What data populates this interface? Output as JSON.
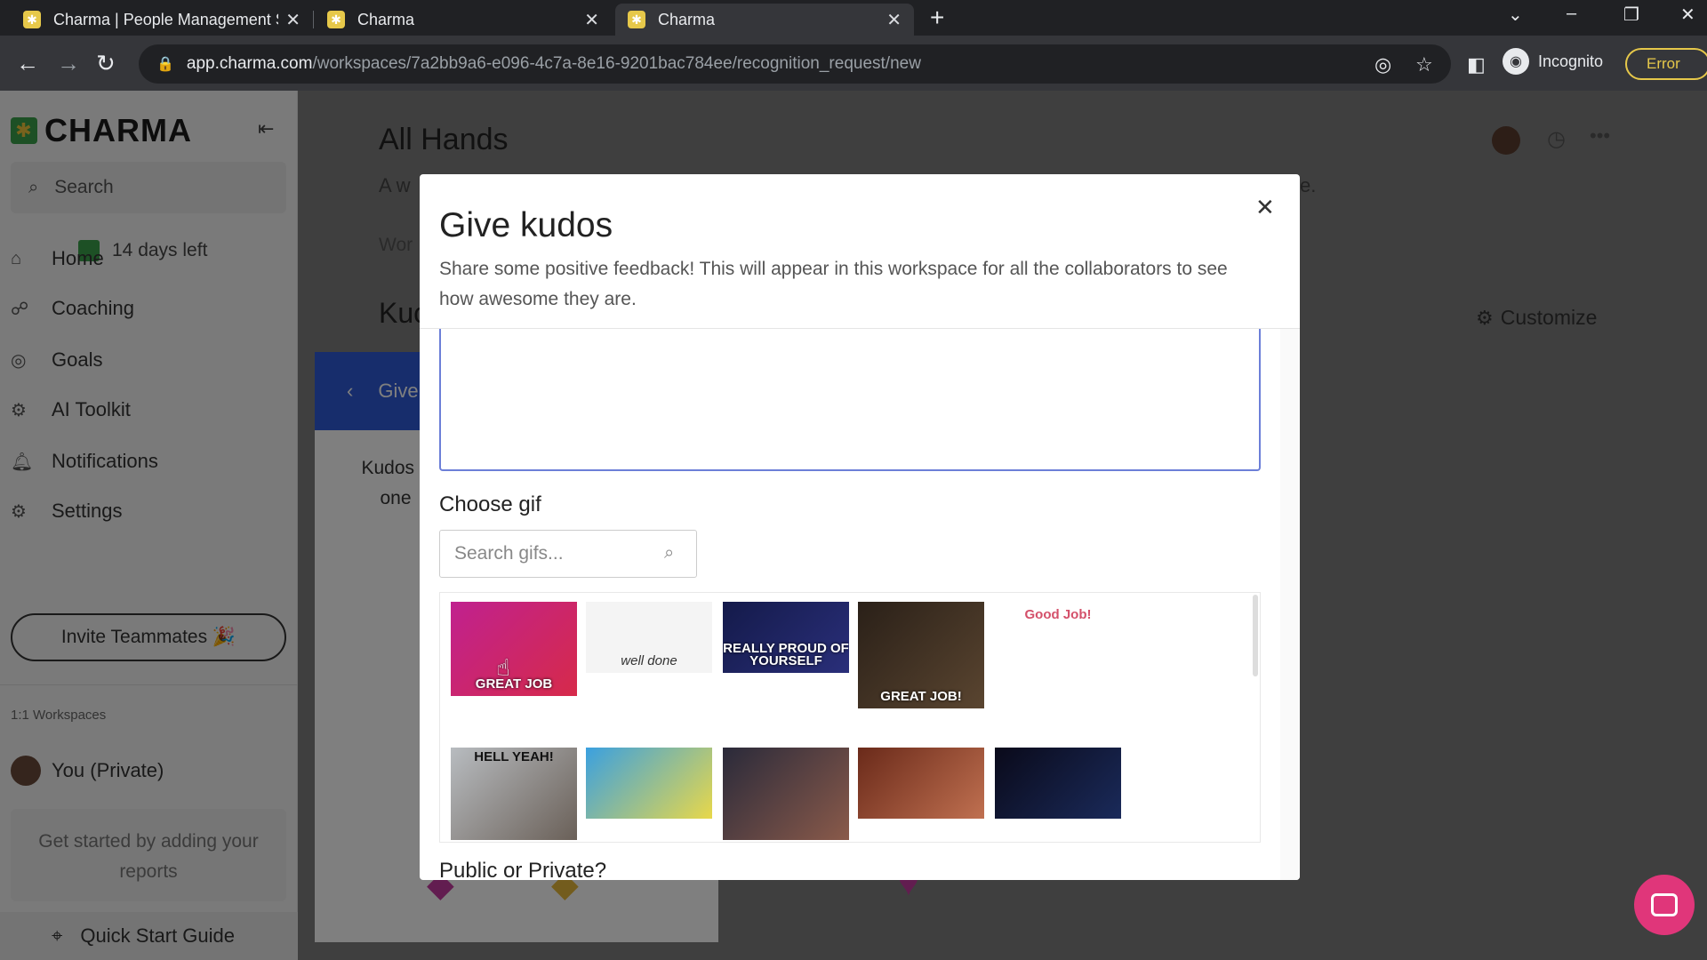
{
  "browser": {
    "tabs": [
      {
        "title": "Charma | People Management S",
        "close": "✕"
      },
      {
        "title": "Charma",
        "close": "✕"
      },
      {
        "title": "Charma",
        "close": "✕"
      }
    ],
    "new_tab": "+",
    "url_host": "app.charma.com",
    "url_path": "/workspaces/7a2bb9a6-e096-4c7a-8e16-9201bac784ee/recognition_request/new",
    "incognito_label": "Incognito",
    "error_label": "Error"
  },
  "sidebar": {
    "brand": "CHARMA",
    "search_label": "Search",
    "trial": "14 days left",
    "items": [
      {
        "label": "Home",
        "icon": "home-icon"
      },
      {
        "label": "Coaching",
        "icon": "coaching-icon"
      },
      {
        "label": "Goals",
        "icon": "goals-icon"
      },
      {
        "label": "AI Toolkit",
        "icon": "robot-icon"
      },
      {
        "label": "Notifications",
        "icon": "bell-icon"
      },
      {
        "label": "Settings",
        "icon": "gear-icon"
      }
    ],
    "invite": "Invite Teammates 🎉",
    "section": "1:1 Workspaces",
    "you": "You (Private)",
    "get_started": "Get started by adding your reports",
    "quick_start": "Quick Start Guide"
  },
  "main": {
    "title": "All Hands",
    "subtitle_start": "A w",
    "subtitle_end": "e.",
    "wor": "Wor",
    "kudos": "Kuc",
    "customize": "Customize",
    "panel_bar": "Give",
    "panel_text": "Kudos a one"
  },
  "modal": {
    "title": "Give kudos",
    "description": "Share some positive feedback! This will appear in this workspace for all the collaborators to see how awesome they are.",
    "close": "✕",
    "choose_gif": "Choose gif",
    "search_placeholder": "Search gifs...",
    "gifs": [
      {
        "caption": "GREAT JOB",
        "colors": [
          "#c0218f",
          "#d62a4a"
        ]
      },
      {
        "caption": "well done",
        "colors": [
          "#f4f4f4",
          "#f4f4f4"
        ]
      },
      {
        "caption": "REALLY PROUD OF YOURSELF",
        "colors": [
          "#141a4a",
          "#2a2f7a"
        ]
      },
      {
        "caption": "GREAT JOB!",
        "colors": [
          "#2a2018",
          "#5a4530"
        ]
      },
      {
        "caption": "Good Job!",
        "colors": [
          "#ffffff",
          "#ffffff"
        ]
      },
      {
        "caption": "HELL YEAH!",
        "colors": [
          "#b8bcc0",
          "#6a6058"
        ]
      },
      {
        "caption": "",
        "colors": [
          "#3aa0e0",
          "#e8d84a"
        ]
      },
      {
        "caption": "",
        "colors": [
          "#2a2a3a",
          "#8a5a4a"
        ]
      },
      {
        "caption": "",
        "colors": [
          "#6a2a1a",
          "#c07050"
        ]
      },
      {
        "caption": "",
        "colors": [
          "#0a0a1a",
          "#1a2a5a"
        ]
      }
    ],
    "public_private": "Public or Private?"
  },
  "colors": {
    "brand_green": "#3aa14a",
    "primary_blue": "#2e5bd8",
    "chat_pink": "#e0367a"
  }
}
